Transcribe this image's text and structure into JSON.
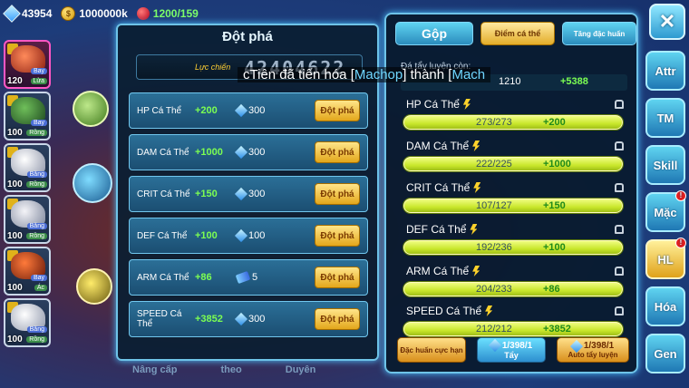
{
  "hud": {
    "gems": "43954",
    "gold": "1000000k",
    "stamina": "1200/159"
  },
  "team": [
    {
      "level": "120",
      "tag1": "Bay",
      "tag2": "Lửa",
      "color": "#d9482e"
    },
    {
      "level": "100",
      "tag1": "Bay",
      "tag2": "Rồng",
      "color": "#3b6e3a"
    },
    {
      "level": "100",
      "tag1": "Băng",
      "tag2": "Rồng",
      "color": "#e6e6ee"
    },
    {
      "level": "100",
      "tag1": "Băng",
      "tag2": "Rồng",
      "color": "#d2d6e6"
    },
    {
      "level": "100",
      "tag1": "Bay",
      "tag2": "Ác",
      "color": "#c43a1f"
    },
    {
      "level": "100",
      "tag1": "Băng",
      "tag2": "Rồng",
      "color": "#dcdfea"
    }
  ],
  "breakthrough": {
    "title": "Đột phá",
    "power_label": "Lực chiến",
    "power_value": "42404622",
    "rows": [
      {
        "name": "HP Cá Thể",
        "bonus": "+200",
        "cost": "300",
        "cost_icon": "gem-icon",
        "button": "Đột phá"
      },
      {
        "name": "DAM Cá Thể",
        "bonus": "+1000",
        "cost": "300",
        "cost_icon": "gem-icon",
        "button": "Đột phá"
      },
      {
        "name": "CRIT Cá Thể",
        "bonus": "+150",
        "cost": "300",
        "cost_icon": "gem-icon",
        "button": "Đột phá"
      },
      {
        "name": "DEF Cá Thể",
        "bonus": "+100",
        "cost": "100",
        "cost_icon": "gem-icon",
        "button": "Đột phá"
      },
      {
        "name": "ARM Cá Thể",
        "bonus": "+86",
        "cost": "5",
        "cost_icon": "ticket-icon",
        "button": "Đột phá"
      },
      {
        "name": "SPEED Cá Thể",
        "bonus": "+3852",
        "cost": "300",
        "cost_icon": "gem-icon",
        "button": "Đột phá"
      }
    ],
    "footer": [
      "Nâng cấp",
      "theo",
      "Duyên"
    ]
  },
  "notice": {
    "prefix": "cTiên đã tiến hóa [",
    "from": "Machop",
    "mid": "] thành [",
    "to": "Mach"
  },
  "right_panel": {
    "tabs": [
      "Gộp",
      "Điểm cá thể",
      "Tăng đặc huấn"
    ],
    "remaining_label": "Đá tẩy luyện còn:",
    "total_value": "1210",
    "total_bonus": "+5388",
    "stats": [
      {
        "name": "HP Cá Thể",
        "current": "273/273",
        "add": "+200"
      },
      {
        "name": "DAM Cá Thể",
        "current": "222/225",
        "add": "+1000"
      },
      {
        "name": "CRIT Cá Thể",
        "current": "107/127",
        "add": "+150"
      },
      {
        "name": "DEF Cá Thể",
        "current": "192/236",
        "add": "+100"
      },
      {
        "name": "ARM Cá Thể",
        "current": "204/233",
        "add": "+86"
      },
      {
        "name": "SPEED Cá Thể",
        "current": "212/212",
        "add": "+3852"
      }
    ],
    "btn_special": "Đặc huấn cực hạn",
    "btn_wash_count": "1/398/1",
    "btn_wash": "Tẩy",
    "btn_auto_count": "1/398/1",
    "btn_auto": "Auto tẩy luyện"
  },
  "close_label": "✕",
  "sidebar": [
    {
      "label": "Attr",
      "badge": ""
    },
    {
      "label": "TM",
      "badge": ""
    },
    {
      "label": "Skill",
      "badge": ""
    },
    {
      "label": "Mặc",
      "badge": "!"
    },
    {
      "label": "HL",
      "badge": "!"
    },
    {
      "label": "Hóa",
      "badge": ""
    },
    {
      "label": "Gen",
      "badge": ""
    }
  ]
}
